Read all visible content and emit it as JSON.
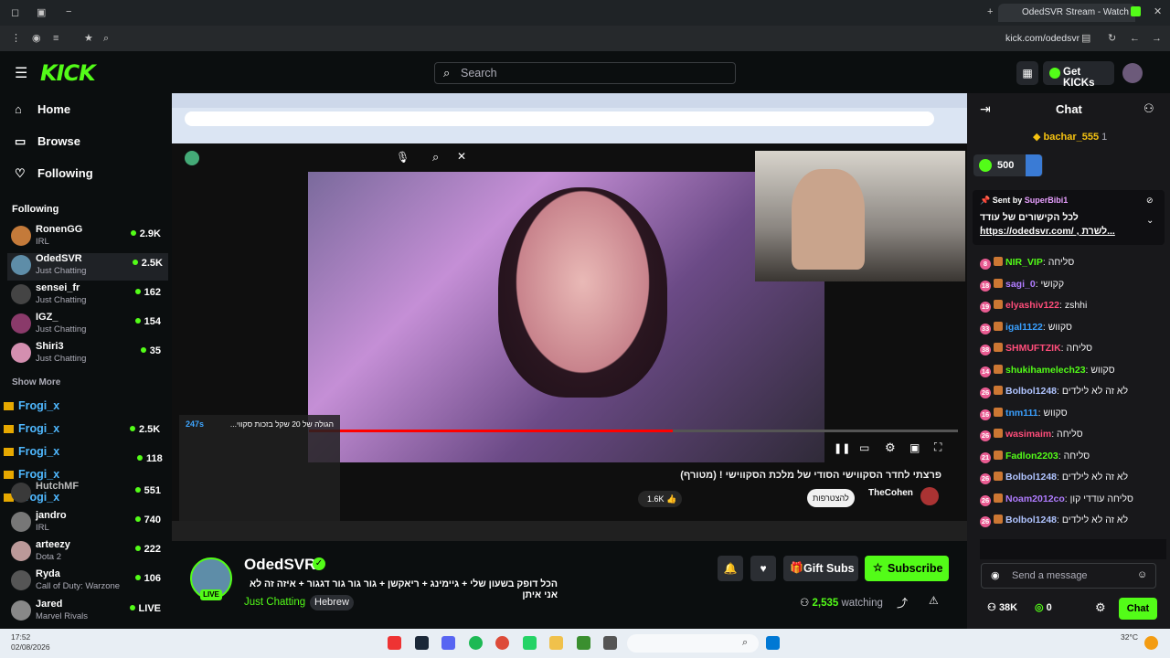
{
  "browser": {
    "tab_title": "OdedSVR Stream - Watch L",
    "url": "kick.com/odedsvr"
  },
  "header": {
    "logo": "KICK",
    "search_placeholder": "Search",
    "get_kicks": "Get KICKs"
  },
  "sidebar": {
    "nav": [
      {
        "label": "Home",
        "icon": "home-icon"
      },
      {
        "label": "Browse",
        "icon": "browse-icon"
      },
      {
        "label": "Following",
        "icon": "heart-icon"
      }
    ],
    "section_title": "Following",
    "channels": [
      {
        "name": "RonenGG",
        "category": "IRL",
        "viewers": "2.9K"
      },
      {
        "name": "OdedSVR",
        "category": "Just Chatting",
        "viewers": "2.5K"
      },
      {
        "name": "sensei_fr",
        "category": "Just Chatting",
        "viewers": "162"
      },
      {
        "name": "IGZ_",
        "category": "Just Chatting",
        "viewers": "154"
      },
      {
        "name": "Shiri3",
        "category": "Just Chatting",
        "viewers": "35"
      }
    ],
    "show_more": "Show More",
    "overlay_user": "Frogi_x",
    "channels2": [
      {
        "name": "",
        "category": "",
        "viewers": "2.5K"
      },
      {
        "name": "",
        "category": "",
        "viewers": "118"
      },
      {
        "name": "HutchMF",
        "category": "",
        "viewers": "551"
      },
      {
        "name": "jandro",
        "category": "IRL",
        "viewers": "740"
      },
      {
        "name": "arteezy",
        "category": "Dota 2",
        "viewers": "222"
      },
      {
        "name": "Ryda",
        "category": "Call of Duty: Warzone",
        "viewers": "106"
      },
      {
        "name": "Jared",
        "category": "Marvel Rivals",
        "viewers": "LIVE"
      }
    ]
  },
  "video": {
    "yt_title": "פרצתי לחדר הסקווישי הסודי של מלכת הסקווישי ! (מטורף)",
    "yt_channel": "TheCohen",
    "yt_subscribe": "להצטרפות",
    "yt_likes": "1.6K",
    "yt_panel_title": "הגולה של 20 שקל בזכות סקווי...",
    "yt_panel_time": "247s",
    "progress": 0.56
  },
  "stream": {
    "name": "OdedSVR",
    "live": "LIVE",
    "title": "הכל דופק בשעון שלי + גיימינג + ריאקשן + גור גור גור דגגור + איזה זה לא אני איתן",
    "category": "Just Chatting",
    "tag": "Hebrew",
    "gift_subs": "Gift Subs",
    "subscribe": "Subscribe",
    "watching_count": "2,535",
    "watching_label": "watching"
  },
  "chat": {
    "title": "Chat",
    "top_gifter": "bachar_555",
    "top_gifter_count": "1",
    "points": "500",
    "pinned_sent_by": "Sent by",
    "pinned_author": "SuperBibi1",
    "pinned_line1": "לכל הקישורים של עודד :",
    "pinned_line2": "https://odedsvr.com/ , לשרת...",
    "messages": [
      {
        "badge": "8",
        "user": "NIR_VIP",
        "color": "#53fc18",
        "text": "סליחה"
      },
      {
        "badge": "18",
        "user": "sagi_0",
        "color": "#b07cff",
        "text": "קקושי"
      },
      {
        "badge": "19",
        "user": "elyashiv122",
        "color": "#ff4d7a",
        "text": "zshhi"
      },
      {
        "badge": "33",
        "user": "igal1122",
        "color": "#3aa0ff",
        "text": "סקווש"
      },
      {
        "badge": "38",
        "user": "SHMUFTZIK",
        "color": "#ff4d7a",
        "text": "סליחה"
      },
      {
        "badge": "14",
        "user": "shukihamelech23",
        "color": "#53fc18",
        "text": "סקווש"
      },
      {
        "badge": "26",
        "user": "Bolbol1248",
        "color": "#b0c4ff",
        "text": "לא זה לא לילדים"
      },
      {
        "badge": "16",
        "user": "tnm111",
        "color": "#3aa0ff",
        "text": "סקווש"
      },
      {
        "badge": "26",
        "user": "wasimaim",
        "color": "#ff4d7a",
        "text": "סליחה"
      },
      {
        "badge": "21",
        "user": "Fadlon2203",
        "color": "#53fc18",
        "text": "סליחה"
      },
      {
        "badge": "26",
        "user": "Bolbol1248",
        "color": "#b0c4ff",
        "text": "לא זה לא לילדים"
      },
      {
        "badge": "26",
        "user": "Noam2012co",
        "color": "#b07cff",
        "text": "סליחה עודדי קון"
      },
      {
        "badge": "26",
        "user": "Bolbol1248",
        "color": "#b0c4ff",
        "text": "לא זה לא לילדים"
      }
    ],
    "input_placeholder": "Send a message",
    "followers": "38K",
    "user_points": "0",
    "chat_button": "Chat"
  },
  "os": {
    "time": "17:52",
    "date": "02/08/2026",
    "weather": "32°C"
  },
  "colors": {
    "accent": "#53fc18",
    "bg": "#0b0e0f",
    "chat_bg": "#18181b"
  }
}
